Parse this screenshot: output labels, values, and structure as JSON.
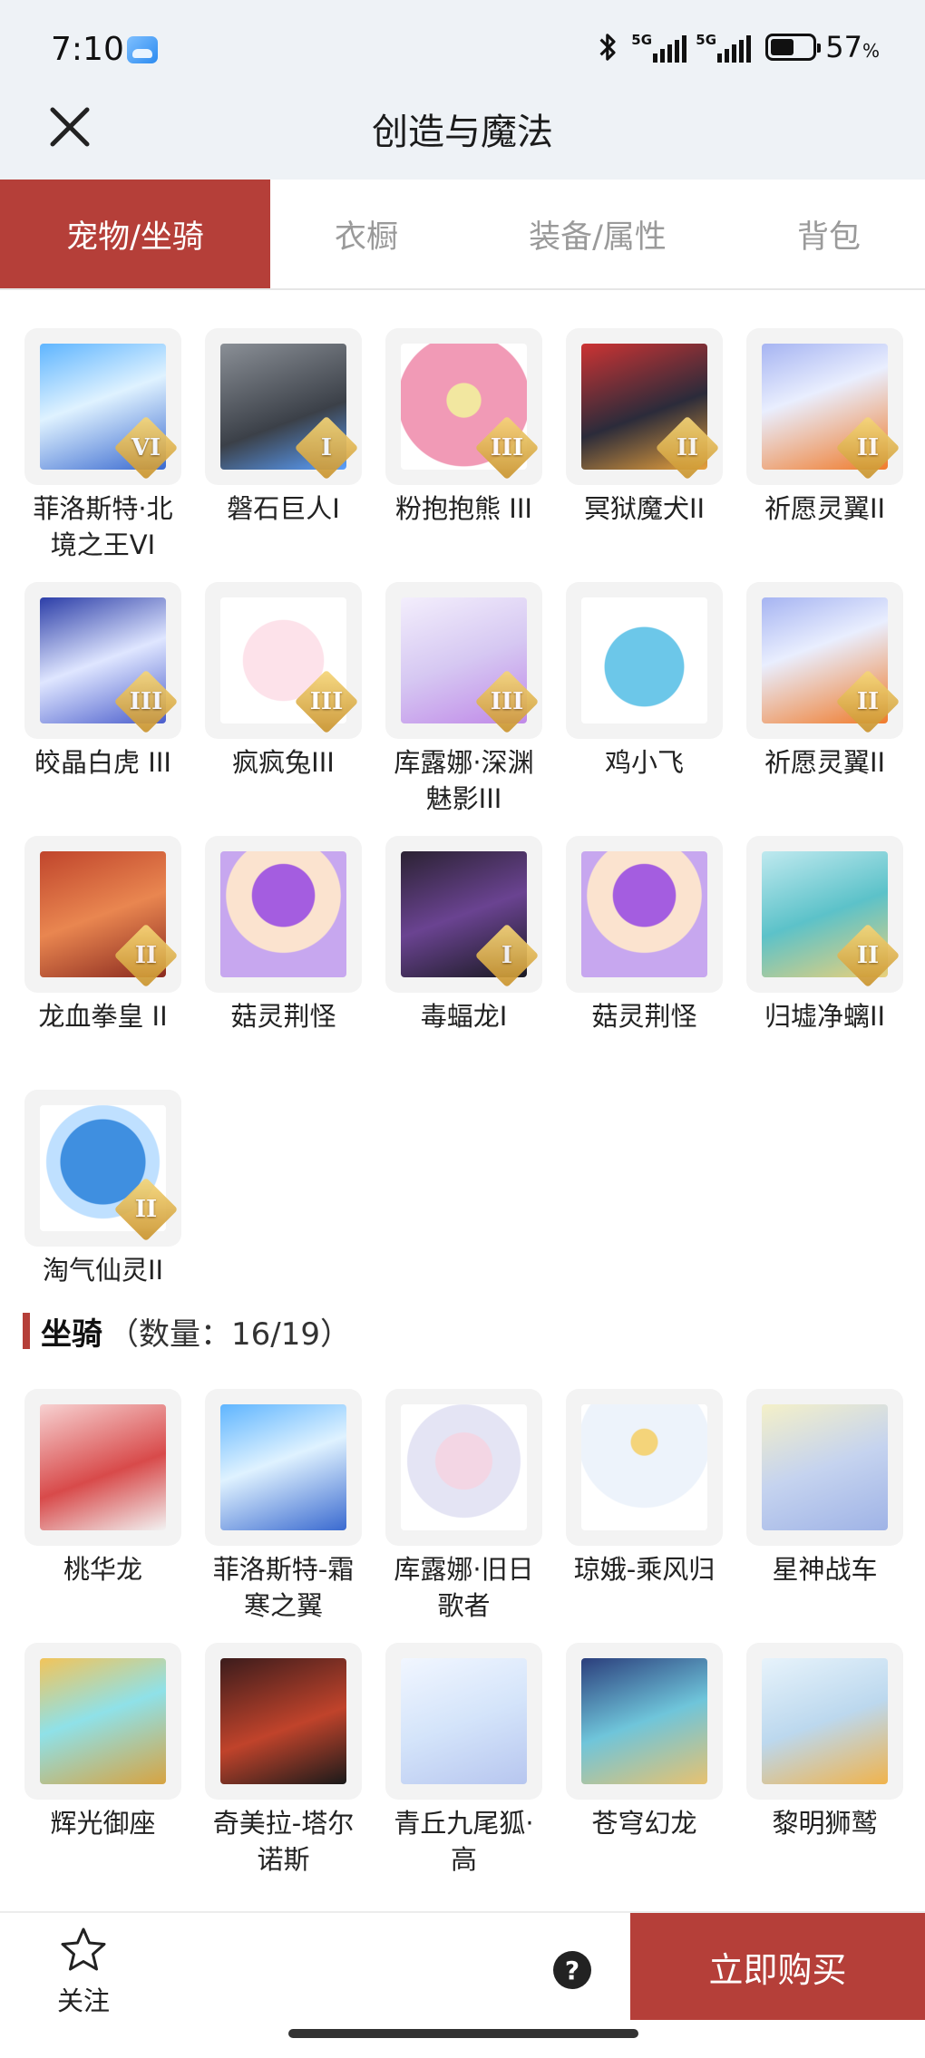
{
  "status_bar": {
    "time": "7:10",
    "net1": "5G",
    "net2": "5G",
    "battery": "57",
    "battery_unit": "%",
    "battery_level": 0.57
  },
  "header": {
    "title": "创造与魔法",
    "close_icon": "close-icon"
  },
  "tabs": [
    {
      "label": "宠物/坐骑",
      "active": true
    },
    {
      "label": "衣橱",
      "active": false
    },
    {
      "label": "装备/属性",
      "active": false
    },
    {
      "label": "背包",
      "active": false
    }
  ],
  "pets": [
    {
      "name": "菲洛斯特·北境之王VI",
      "badge": "VI"
    },
    {
      "name": "磐石巨人Ⅰ",
      "badge": "I"
    },
    {
      "name": "粉抱抱熊 III",
      "badge": "III"
    },
    {
      "name": "冥狱魔犬II",
      "badge": "II"
    },
    {
      "name": "祈愿灵翼II",
      "badge": "II"
    },
    {
      "name": "皎晶白虎 III",
      "badge": "III"
    },
    {
      "name": "疯疯兔III",
      "badge": "III"
    },
    {
      "name": "库露娜·深渊魅影III",
      "badge": "III"
    },
    {
      "name": "鸡小飞",
      "badge": ""
    },
    {
      "name": "祈愿灵翼II",
      "badge": "II"
    },
    {
      "name": "龙血拳皇 II",
      "badge": "II"
    },
    {
      "name": "菇灵荆怪",
      "badge": ""
    },
    {
      "name": "毒蝠龙Ⅰ",
      "badge": "I"
    },
    {
      "name": "菇灵荆怪",
      "badge": ""
    },
    {
      "name": "归墟净螭II",
      "badge": "II"
    },
    {
      "name": "淘气仙灵II",
      "badge": "II"
    }
  ],
  "mounts_section": {
    "label": "坐骑",
    "count": "（数量：16/19）"
  },
  "mounts": [
    {
      "name": "桃华龙"
    },
    {
      "name": "菲洛斯特-霜寒之翼"
    },
    {
      "name": "库露娜·旧日歌者"
    },
    {
      "name": "琼娥-乘风归"
    },
    {
      "name": "星神战车"
    },
    {
      "name": "辉光御座"
    },
    {
      "name": "奇美拉-塔尔诺斯"
    },
    {
      "name": "青丘九尾狐·高"
    },
    {
      "name": "苍穹幻龙"
    },
    {
      "name": "黎明狮鹫"
    }
  ],
  "bottom_bar": {
    "follow_label": "关注",
    "help_symbol": "?",
    "buy_label": "立即购买"
  }
}
